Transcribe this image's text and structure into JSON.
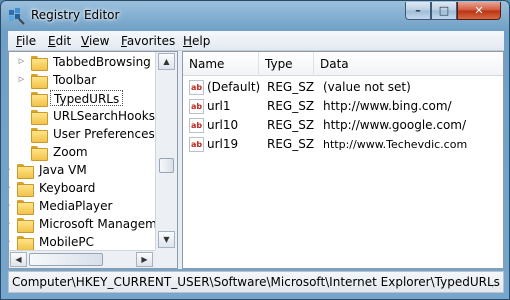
{
  "window": {
    "title": "Registry Editor",
    "controls": {
      "minimize": "–",
      "maximize": "□",
      "close": "✕"
    }
  },
  "menu": [
    "File",
    "Edit",
    "View",
    "Favorites",
    "Help"
  ],
  "tree": {
    "items": [
      {
        "label": "TabbedBrowsing",
        "expander": "▷"
      },
      {
        "label": "Toolbar",
        "expander": "▷"
      },
      {
        "label": "TypedURLs",
        "expander": "",
        "selected": true
      },
      {
        "label": "URLSearchHooks",
        "expander": ""
      },
      {
        "label": "User Preferences",
        "expander": ""
      },
      {
        "label": "Zoom",
        "expander": ""
      },
      {
        "label": "Java VM",
        "expander": "▷"
      },
      {
        "label": "Keyboard",
        "expander": "▷"
      },
      {
        "label": "MediaPlayer",
        "expander": "▷"
      },
      {
        "label": "Microsoft Managemen",
        "expander": "▷"
      },
      {
        "label": "MobilePC",
        "expander": "▷"
      }
    ]
  },
  "list": {
    "columns": [
      "Name",
      "Type",
      "Data"
    ],
    "rows": [
      {
        "name": "(Default)",
        "type": "REG_SZ",
        "data": "(value not set)"
      },
      {
        "name": "url1",
        "type": "REG_SZ",
        "data": "http://www.bing.com/"
      },
      {
        "name": "url10",
        "type": "REG_SZ",
        "data": "http://www.google.com/"
      },
      {
        "name": "url19",
        "type": "REG_SZ",
        "data": "http://www.Techevdic.com"
      }
    ],
    "icon_text": "ab"
  },
  "status": {
    "path": "Computer\\HKEY_CURRENT_USER\\Software\\Microsoft\\Internet Explorer\\TypedURLs"
  },
  "colors": {
    "title_bar": "#76a6cc",
    "close_button": "#c83c1a",
    "folder": "#f1c24a",
    "icon_text": "#c0281e"
  }
}
